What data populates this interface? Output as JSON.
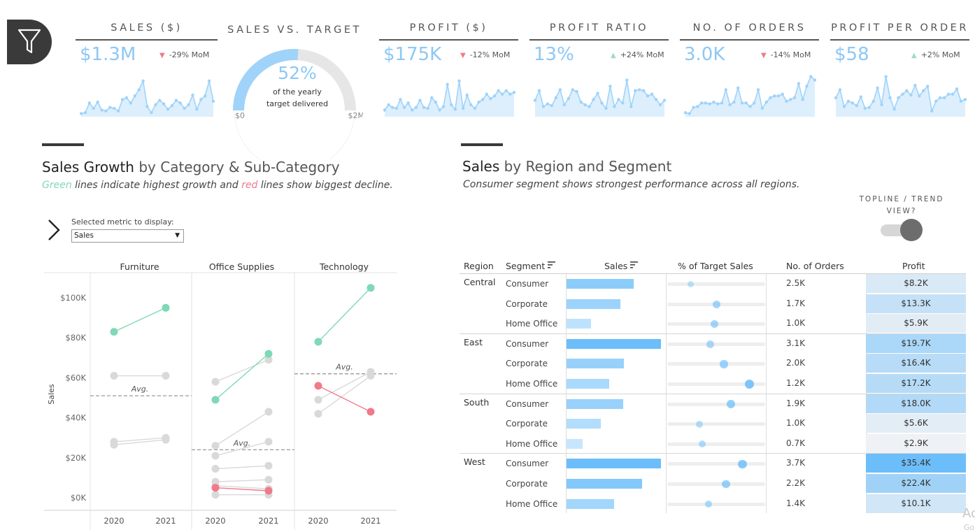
{
  "filter": {
    "icon": "filter-icon"
  },
  "kpis": [
    {
      "key": "sales",
      "title": "SALES ($)",
      "value": "$1.3M",
      "mom": "-29% MoM",
      "dir": "down",
      "spark": [
        2,
        3,
        14,
        8,
        15,
        6,
        5,
        9,
        8,
        5,
        18,
        20,
        14,
        22,
        29,
        39,
        10,
        3,
        12,
        17,
        13,
        7,
        11,
        17,
        14,
        8,
        12,
        23,
        7,
        18,
        22,
        39,
        16
      ]
    },
    {
      "key": "profit",
      "title": "PROFIT ($)",
      "value": "$175K",
      "mom": "-12% MoM",
      "dir": "down",
      "spark": [
        6,
        12,
        9,
        8,
        18,
        9,
        14,
        6,
        9,
        17,
        9,
        8,
        20,
        15,
        6,
        10,
        35,
        12,
        7,
        39,
        8,
        23,
        12,
        8,
        15,
        18,
        24,
        19,
        22,
        28,
        24,
        28,
        24,
        26
      ]
    },
    {
      "key": "profit_ratio",
      "title": "PROFIT RATIO",
      "value": "13%",
      "mom": "+24% MoM",
      "dir": "up",
      "spark": [
        17,
        28,
        10,
        13,
        11,
        20,
        29,
        12,
        19,
        29,
        27,
        15,
        12,
        10,
        18,
        25,
        14,
        8,
        33,
        10,
        18,
        14,
        40,
        10,
        28,
        29,
        28,
        22,
        24,
        18,
        12,
        17
      ]
    },
    {
      "key": "orders",
      "title": "NO. OF ORDERS",
      "value": "3.0K",
      "mom": "-14% MoM",
      "dir": "down",
      "spark": [
        3,
        2,
        9,
        10,
        14,
        14,
        13,
        15,
        13,
        14,
        29,
        12,
        15,
        31,
        14,
        14,
        10,
        14,
        29,
        8,
        15,
        20,
        22,
        22,
        24,
        16,
        18,
        20,
        36,
        18,
        33,
        44,
        40
      ]
    },
    {
      "key": "ppo",
      "title": "PROFIT PER ORDER",
      "value": "$58",
      "mom": "+2% MoM",
      "dir": "up",
      "spark": [
        20,
        29,
        10,
        16,
        14,
        11,
        21,
        8,
        9,
        16,
        31,
        12,
        44,
        20,
        7,
        20,
        24,
        28,
        23,
        34,
        22,
        28,
        33,
        5,
        16,
        20,
        20,
        24,
        24,
        30,
        16,
        18
      ]
    }
  ],
  "gauge": {
    "title": "SALES VS. TARGET",
    "percent": "52%",
    "fraction": 0.52,
    "caption1": "of the yearly",
    "caption2": "target delivered",
    "min_label": "$0",
    "max_label": "$2M"
  },
  "left": {
    "title_bold": "Sales Growth",
    "title_rest": " by Category & Sub-Category",
    "sub_green": "Green",
    "sub_mid": " lines indicate highest growth and ",
    "sub_red": "red",
    "sub_end": " lines show biggest decline.",
    "selector_label": "Selected metric to display:",
    "selector_value": "Sales",
    "chevron_icon": "chevron-right-icon",
    "dropdown_icon": "dropdown-arrow-icon"
  },
  "right": {
    "title_bold": "Sales",
    "title_rest": " by Region and Segment",
    "subtitle": "Consumer segment shows strongest performance across all regions.",
    "toggle_label": "TOPLINE / TREND VIEW?"
  },
  "chart_data": {
    "type": "line",
    "ylabel": "Sales",
    "ylim": [
      0,
      105000
    ],
    "yticks": [
      "$0K",
      "$20K",
      "$40K",
      "$60K",
      "$80K",
      "$100K"
    ],
    "years": [
      "2020",
      "2021"
    ],
    "avg_label": "Avg.",
    "colors": {
      "green": "#7fd8b6",
      "red": "#f07a8a",
      "grey": "#d9d9d9"
    },
    "panels": [
      {
        "category": "Furniture",
        "avg": 51000,
        "series": [
          {
            "values": [
              83000,
              95000
            ],
            "status": "green"
          },
          {
            "values": [
              61000,
              61000
            ],
            "status": "grey"
          },
          {
            "values": [
              28000,
              30000
            ],
            "status": "grey"
          },
          {
            "values": [
              26500,
              29000
            ],
            "status": "grey"
          }
        ]
      },
      {
        "category": "Office Supplies",
        "avg": 24000,
        "series": [
          {
            "values": [
              58000,
              69000
            ],
            "status": "grey"
          },
          {
            "values": [
              26000,
              43000
            ],
            "status": "grey"
          },
          {
            "values": [
              21000,
              28000
            ],
            "status": "grey"
          },
          {
            "values": [
              14500,
              16000
            ],
            "status": "grey"
          },
          {
            "values": [
              8000,
              9000
            ],
            "status": "grey"
          },
          {
            "values": [
              6000,
              4500
            ],
            "status": "grey"
          },
          {
            "values": [
              1500,
              1500
            ],
            "status": "grey"
          },
          {
            "values": [
              49000,
              72000
            ],
            "status": "green"
          },
          {
            "values": [
              5000,
              3500
            ],
            "status": "red"
          }
        ]
      },
      {
        "category": "Technology",
        "avg": 62000,
        "series": [
          {
            "values": [
              78000,
              105000
            ],
            "status": "green"
          },
          {
            "values": [
              49000,
              63000
            ],
            "status": "grey"
          },
          {
            "values": [
              42000,
              61000
            ],
            "status": "grey"
          },
          {
            "values": [
              56000,
              43000
            ],
            "status": "red"
          }
        ]
      }
    ]
  },
  "table": {
    "headers": {
      "region": "Region",
      "segment": "Segment",
      "sales": "Sales",
      "target": "% of Target Sales",
      "orders": "No. of Orders",
      "profit": "Profit"
    },
    "sort_icon": "sort-icon",
    "rows": [
      {
        "region": "Central",
        "segment": "Consumer",
        "sales": 0.71,
        "target": 0.24,
        "orders": "2.5K",
        "profit": "$8.2K",
        "pv": 8.2
      },
      {
        "region": "",
        "segment": "Corporate",
        "sales": 0.57,
        "target": 0.5,
        "orders": "1.7K",
        "profit": "$13.3K",
        "pv": 13.3
      },
      {
        "region": "",
        "segment": "Home Office",
        "sales": 0.26,
        "target": 0.48,
        "orders": "1.0K",
        "profit": "$5.9K",
        "pv": 5.9
      },
      {
        "region": "East",
        "segment": "Consumer",
        "sales": 1.0,
        "target": 0.44,
        "orders": "3.1K",
        "profit": "$19.7K",
        "pv": 19.7
      },
      {
        "region": "",
        "segment": "Corporate",
        "sales": 0.61,
        "target": 0.58,
        "orders": "2.0K",
        "profit": "$16.4K",
        "pv": 16.4
      },
      {
        "region": "",
        "segment": "Home Office",
        "sales": 0.45,
        "target": 0.84,
        "orders": "1.2K",
        "profit": "$17.2K",
        "pv": 17.2
      },
      {
        "region": "South",
        "segment": "Consumer",
        "sales": 0.6,
        "target": 0.65,
        "orders": "1.9K",
        "profit": "$18.0K",
        "pv": 18.0
      },
      {
        "region": "",
        "segment": "Corporate",
        "sales": 0.36,
        "target": 0.33,
        "orders": "1.0K",
        "profit": "$5.6K",
        "pv": 5.6
      },
      {
        "region": "",
        "segment": "Home Office",
        "sales": 0.17,
        "target": 0.36,
        "orders": "0.7K",
        "profit": "$2.9K",
        "pv": 2.9
      },
      {
        "region": "West",
        "segment": "Consumer",
        "sales": 1.0,
        "target": 0.77,
        "orders": "3.7K",
        "profit": "$35.4K",
        "pv": 35.4
      },
      {
        "region": "",
        "segment": "Corporate",
        "sales": 0.8,
        "target": 0.6,
        "orders": "2.2K",
        "profit": "$22.4K",
        "pv": 22.4
      },
      {
        "region": "",
        "segment": "Home Office",
        "sales": 0.5,
        "target": 0.42,
        "orders": "1.4K",
        "profit": "$10.1K",
        "pv": 10.1
      }
    ]
  },
  "watermark": {
    "line1": "Ac",
    "line2": "Go"
  }
}
